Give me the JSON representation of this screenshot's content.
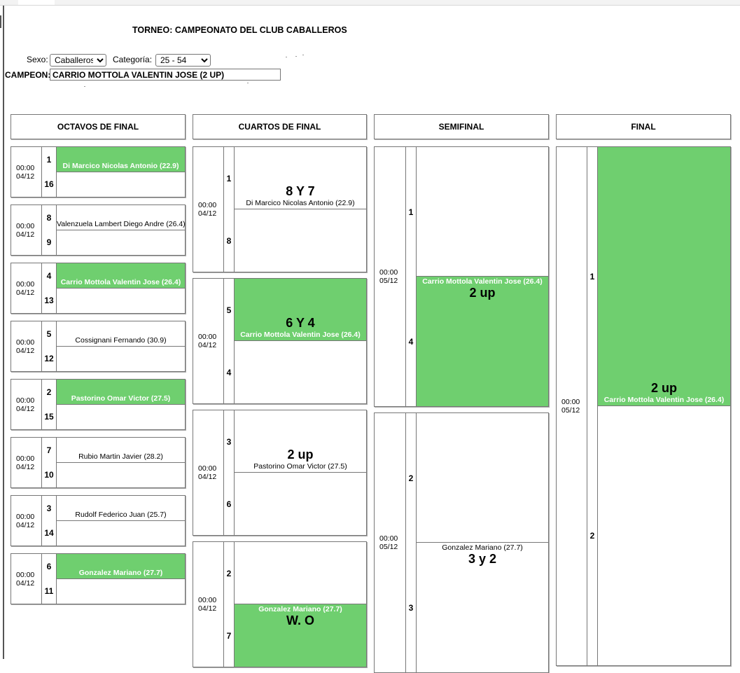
{
  "title": "TORNEO: CAMPEONATO DEL CLUB CABALLEROS",
  "filters": {
    "sexo_label": "Sexo:",
    "sexo_value": "Caballeros",
    "categoria_label": "Categoría:",
    "categoria_value": "25 - 54"
  },
  "champion": {
    "label": "CAMPEON:",
    "value": "CARRIO MOTTOLA VALENTIN JOSE (2 UP)"
  },
  "rounds": [
    "OCTAVOS DE FINAL",
    "CUARTOS DE FINAL",
    "SEMIFINAL",
    "FINAL"
  ],
  "octavos": [
    {
      "time": "00:00",
      "date": "04/12",
      "seed1": "1",
      "seed2": "16",
      "winner": "Di Marcico Nicolas Antonio (22.9)",
      "green": true
    },
    {
      "time": "00:00",
      "date": "04/12",
      "seed1": "8",
      "seed2": "9",
      "winner": "Valenzuela Lambert Diego Andre (26.4)",
      "green": false
    },
    {
      "time": "00:00",
      "date": "04/12",
      "seed1": "4",
      "seed2": "13",
      "winner": "Carrio Mottola Valentin Jose (26.4)",
      "green": true
    },
    {
      "time": "00:00",
      "date": "04/12",
      "seed1": "5",
      "seed2": "12",
      "winner": "Cossignani Fernando (30.9)",
      "green": false
    },
    {
      "time": "00:00",
      "date": "04/12",
      "seed1": "2",
      "seed2": "15",
      "winner": "Pastorino Omar Victor (27.5)",
      "green": true
    },
    {
      "time": "00:00",
      "date": "04/12",
      "seed1": "7",
      "seed2": "10",
      "winner": "Rubio Martin Javier (28.2)",
      "green": false
    },
    {
      "time": "00:00",
      "date": "04/12",
      "seed1": "3",
      "seed2": "14",
      "winner": "Rudolf Federico Juan (25.7)",
      "green": false
    },
    {
      "time": "00:00",
      "date": "04/12",
      "seed1": "6",
      "seed2": "11",
      "winner": "Gonzalez Mariano (27.7)",
      "green": true
    }
  ],
  "cuartos": [
    {
      "time": "00:00",
      "date": "04/12",
      "seed1": "1",
      "seed2": "8",
      "result": "8 Y 7",
      "winner": "Di Marcico Nicolas Antonio (22.9)",
      "pos": "top",
      "green": false
    },
    {
      "time": "00:00",
      "date": "04/12",
      "seed1": "5",
      "seed2": "4",
      "result": "6 Y 4",
      "winner": "Carrio Mottola Valentin Jose (26.4)",
      "pos": "top",
      "green": true
    },
    {
      "time": "00:00",
      "date": "04/12",
      "seed1": "3",
      "seed2": "6",
      "result": "2 up",
      "winner": "Pastorino Omar Victor (27.5)",
      "pos": "top",
      "green": false
    },
    {
      "time": "00:00",
      "date": "04/12",
      "seed1": "2",
      "seed2": "7",
      "result": "W. O",
      "winner": "Gonzalez Mariano (27.7)",
      "pos": "bottom",
      "green": true
    }
  ],
  "semifinal": [
    {
      "time": "00:00",
      "date": "05/12",
      "seed1": "1",
      "seed2": "4",
      "result": "2 up",
      "winner": "Carrio Mottola Valentin Jose (26.4)",
      "pos": "bottom",
      "green": true
    },
    {
      "time": "00:00",
      "date": "05/12",
      "seed1": "2",
      "seed2": "3",
      "result": "3 y 2",
      "winner": "Gonzalez Mariano (27.7)",
      "pos": "bottom",
      "green": false
    }
  ],
  "final": {
    "time": "00:00",
    "date": "05/12",
    "seed1": "1",
    "seed2": "2",
    "result": "2 up",
    "winner": "Carrio Mottola Valentin Jose (26.4)",
    "pos": "top",
    "green": true
  }
}
